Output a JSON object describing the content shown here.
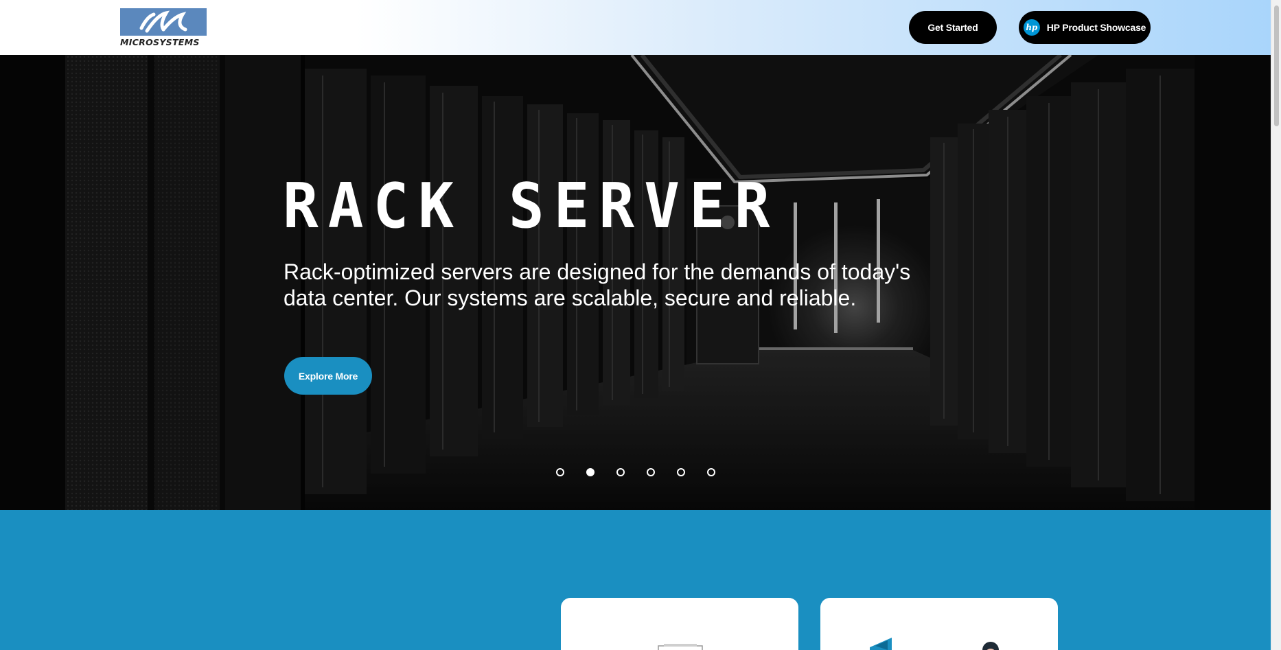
{
  "header": {
    "logo_text": "MICROSYSTEMS",
    "get_started_label": "Get Started",
    "hp_label": "HP Product Showcase",
    "hp_icon_text": "hp"
  },
  "hero": {
    "title": "RACK SERVER",
    "description": "Rack-optimized servers are designed for the demands of today's data center. Our systems are scalable, secure and reliable.",
    "cta_label": "Explore More",
    "slides_total": 6,
    "active_slide": 2
  },
  "colors": {
    "brand_blue": "#1a8fc1",
    "logo_blue": "#5b88bd",
    "header_gradient_end": "#a9d5fb",
    "button_dark": "#000000",
    "hp_blue": "#0096d6"
  },
  "icons": {
    "logo": "microsystems-logo-icon",
    "hp": "hp-logo-icon"
  }
}
